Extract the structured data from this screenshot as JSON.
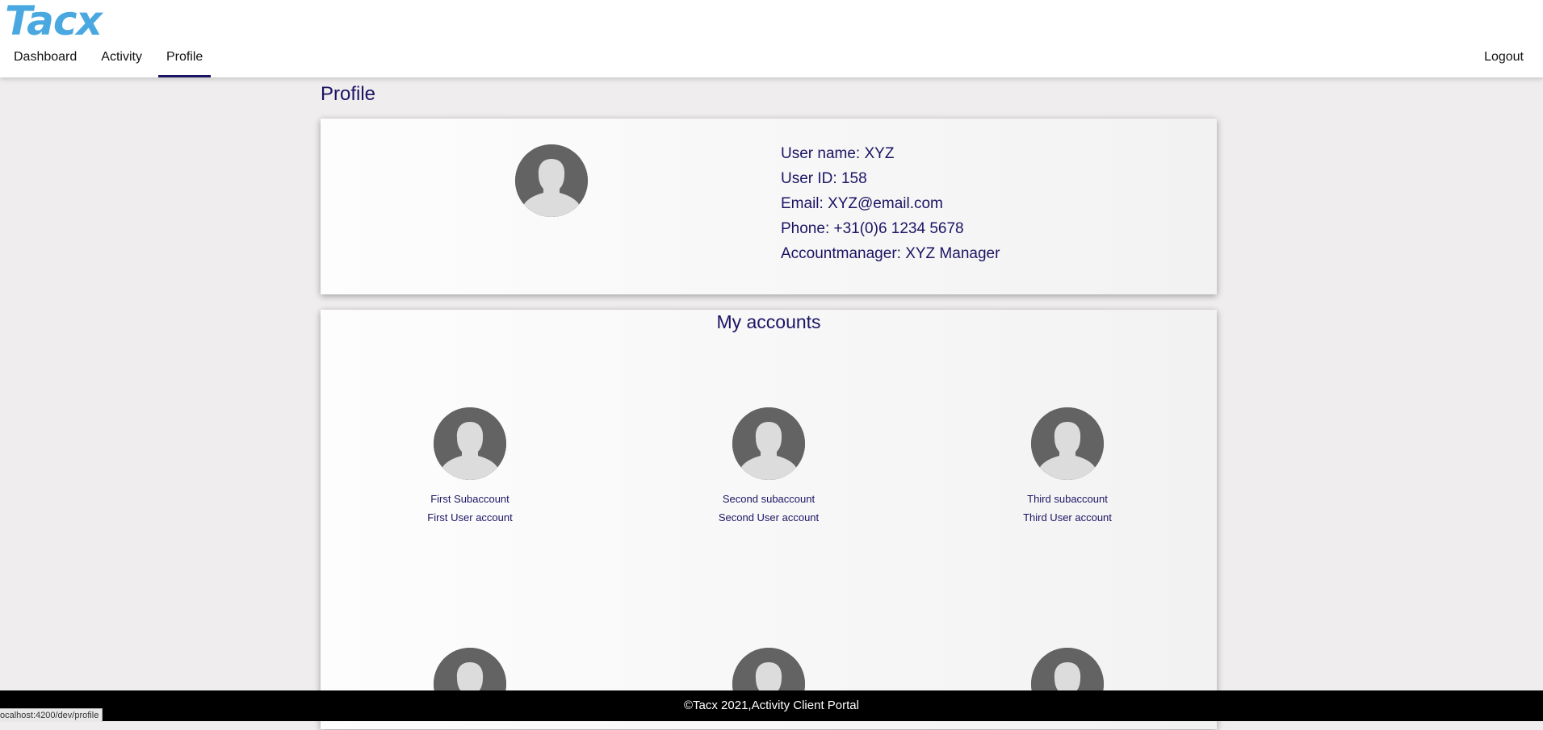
{
  "header": {
    "logo_text": "Tacx",
    "logo_color": "#4aa8e0",
    "nav": [
      {
        "label": "Dashboard",
        "active": false
      },
      {
        "label": "Activity",
        "active": false
      },
      {
        "label": "Profile",
        "active": true
      }
    ],
    "logout_label": "Logout"
  },
  "page": {
    "title": "Profile"
  },
  "profile": {
    "avatar_icon": "user-avatar-icon",
    "user_name": "User name: XYZ",
    "user_id": "User ID: 158",
    "email": "Email: XYZ@email.com",
    "phone": "Phone: +31(0)6 1234 5678",
    "account_manager": "Accountmanager: XYZ Manager"
  },
  "accounts": {
    "title": "My accounts",
    "items": [
      {
        "name": "First Subaccount",
        "desc": "First User account"
      },
      {
        "name": "Second subaccount",
        "desc": "Second User account"
      },
      {
        "name": "Third subaccount",
        "desc": "Third User account"
      },
      {
        "name": "",
        "desc": ""
      },
      {
        "name": "",
        "desc": ""
      },
      {
        "name": "",
        "desc": ""
      }
    ]
  },
  "footer": {
    "text": "©Tacx 2021,Activity Client Portal"
  },
  "status_bar": {
    "url": "ocalhost:4200/dev/profile"
  },
  "colors": {
    "primary_text": "#1b1464",
    "background": "#efeded",
    "footer_bg": "#000000",
    "avatar_bg": "#636363"
  }
}
